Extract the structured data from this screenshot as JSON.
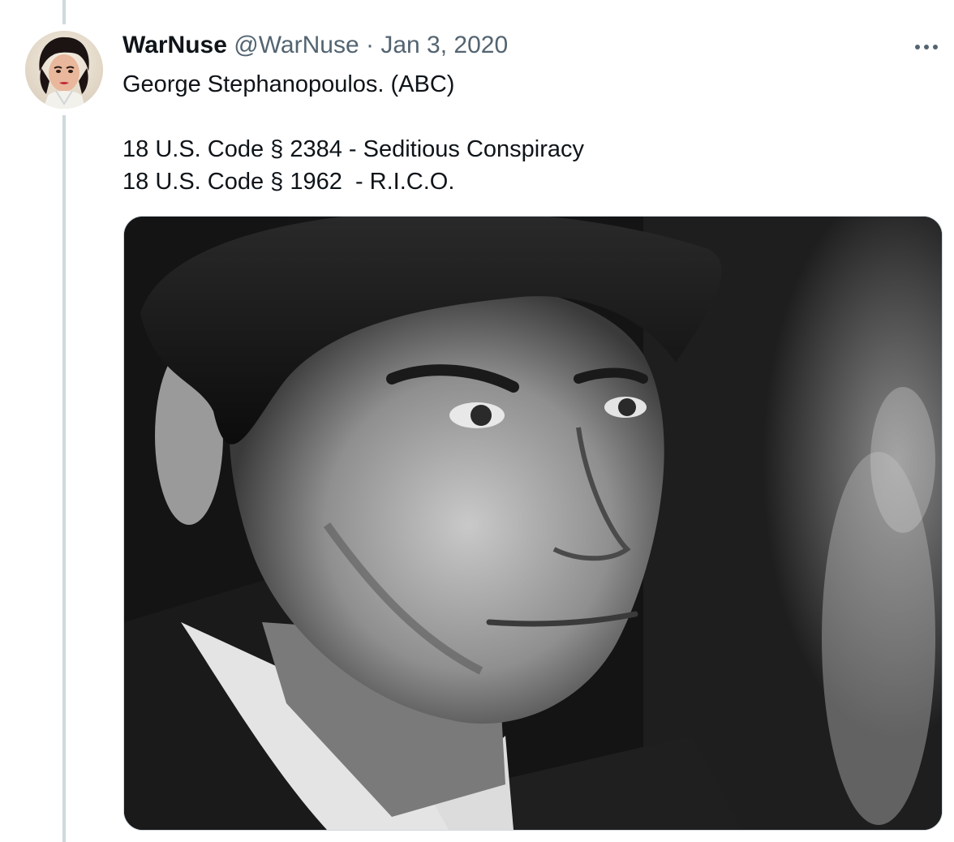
{
  "tweet": {
    "author_name": "WarNuse",
    "author_handle": "@WarNuse",
    "separator": "·",
    "date": "Jan 3, 2020",
    "text_lines": [
      "George Stephanopoulos. (ABC)",
      "",
      "18 U.S. Code § 2384 - Seditious Conspiracy",
      "18 U.S. Code § 1962  - R.I.C.O."
    ]
  },
  "icons": {
    "more": "more-options-icon"
  },
  "colors": {
    "text_primary": "#0f1419",
    "text_secondary": "#536471",
    "thread_line": "#cfd9de",
    "media_border": "#cfd9de"
  }
}
